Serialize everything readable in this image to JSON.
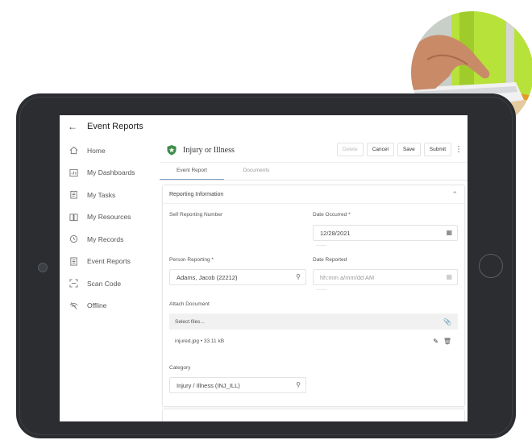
{
  "app": {
    "title": "Event Reports",
    "back_icon": "arrow-left-icon"
  },
  "sidebar": {
    "items": [
      {
        "label": "Home",
        "icon": "home-icon"
      },
      {
        "label": "My Dashboards",
        "icon": "dashboard-icon"
      },
      {
        "label": "My Tasks",
        "icon": "clipboard-icon"
      },
      {
        "label": "My Resources",
        "icon": "book-icon"
      },
      {
        "label": "My Records",
        "icon": "records-icon"
      },
      {
        "label": "Event Reports",
        "icon": "report-icon"
      },
      {
        "label": "Scan Code",
        "icon": "scan-icon"
      },
      {
        "label": "Offline",
        "icon": "offline-icon"
      }
    ]
  },
  "header": {
    "title": "Injury or Illness",
    "buttons": {
      "delete": "Delete",
      "cancel": "Cancel",
      "save": "Save",
      "submit": "Submit"
    }
  },
  "tabs": [
    {
      "label": "Event Report",
      "active": true
    },
    {
      "label": "Documents",
      "active": false
    }
  ],
  "form": {
    "section_title": "Reporting Information",
    "self_reporting_label": "Self Reporting Number",
    "date_occurred_label": "Date Occurred *",
    "date_occurred_value": "12/28/2021",
    "person_reporting_label": "Person Reporting *",
    "person_reporting_value": "Adams, Jacob (22212)",
    "date_reported_label": "Date Reported",
    "date_reported_placeholder": "hh:mm a/mm/dd AM",
    "attach_label": "Attach Document",
    "select_files": "Select files...",
    "attached_file": "injured.jpg • 33.11 kB",
    "category_label": "Category",
    "category_value": "Injury / Illness (INJ_ILL)"
  },
  "colors": {
    "tablet_bezel": "#2b2d30",
    "accent_tab": "#7ea0c6",
    "shield_green": "#3e8e4a",
    "vest_green": "#b7e23a"
  }
}
